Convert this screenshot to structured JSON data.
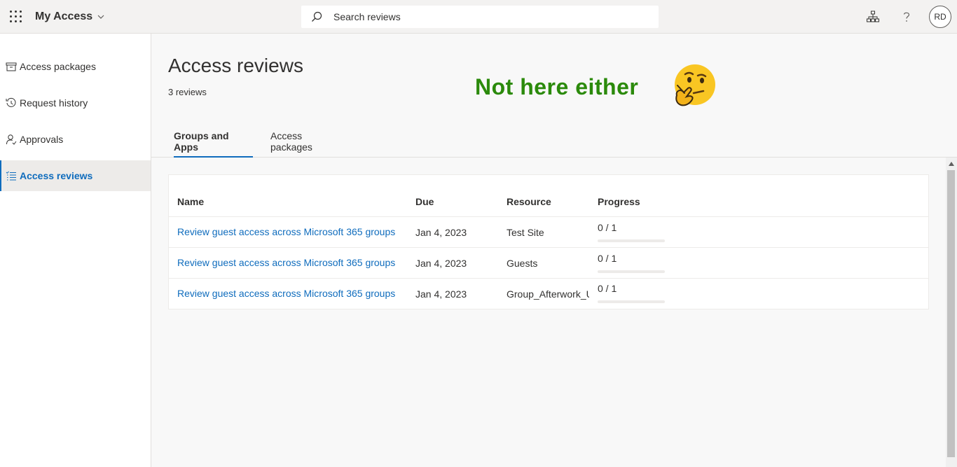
{
  "header": {
    "app_title": "My Access",
    "search_placeholder": "Search reviews",
    "avatar_initials": "RD",
    "icons": [
      "waffle-icon",
      "chevron-down-icon",
      "search-icon",
      "org-chart-icon",
      "help-icon"
    ]
  },
  "sidebar": {
    "items": [
      {
        "label": "Access packages",
        "icon": "package-icon",
        "active": false
      },
      {
        "label": "Request history",
        "icon": "history-icon",
        "active": false
      },
      {
        "label": "Approvals",
        "icon": "person-check-icon",
        "active": false
      },
      {
        "label": "Access reviews",
        "icon": "checklist-icon",
        "active": true
      }
    ]
  },
  "main": {
    "title": "Access reviews",
    "subtitle": "3 reviews",
    "overlay_text": "Not here either",
    "overlay_icon": "thinking-face-icon",
    "tabs": [
      {
        "label": "Groups and Apps",
        "active": true
      },
      {
        "label": "Access packages",
        "active": false
      }
    ],
    "table": {
      "columns": [
        "Name",
        "Due",
        "Resource",
        "Progress"
      ],
      "rows": [
        {
          "name": "Review guest access across Microsoft 365 groups",
          "due": "Jan 4, 2023",
          "resource": "Test Site",
          "progress": "0 / 1",
          "progress_fraction": 0
        },
        {
          "name": "Review guest access across Microsoft 365 groups",
          "due": "Jan 4, 2023",
          "resource": "Guests",
          "progress": "0 / 1",
          "progress_fraction": 0
        },
        {
          "name": "Review guest access across Microsoft 365 groups",
          "due": "Jan 4, 2023",
          "resource": "Group_Afterwork_U",
          "progress": "0 / 1",
          "progress_fraction": 0
        }
      ]
    }
  },
  "colors": {
    "accent": "#0f6cbd",
    "overlay_text": "#2b8a0b",
    "topbar_bg": "#f3f2f1",
    "content_bg": "#f8f8f8"
  }
}
